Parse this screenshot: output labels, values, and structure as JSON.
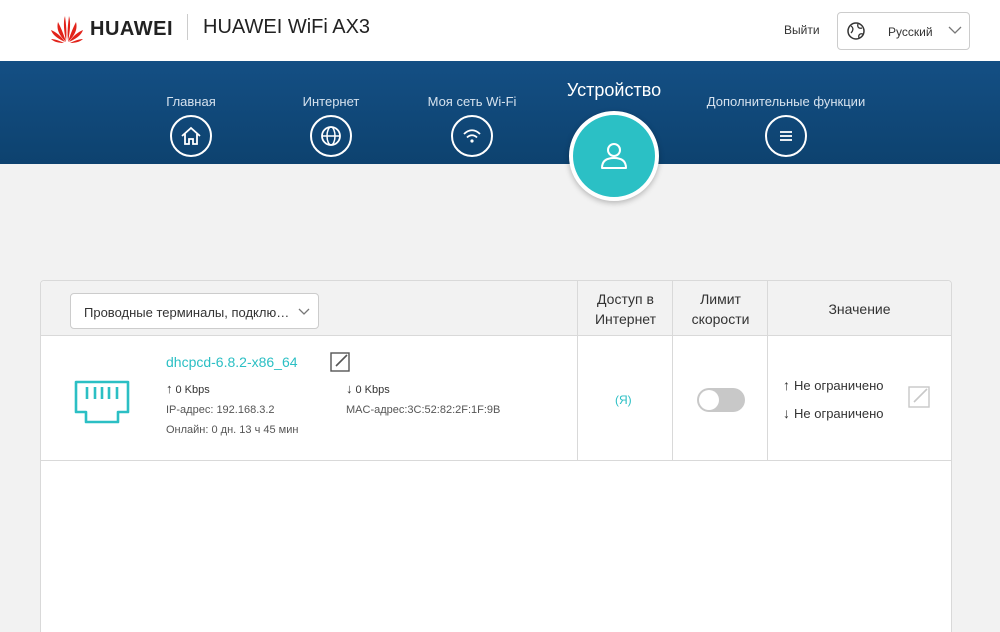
{
  "header": {
    "brand": "HUAWEI",
    "product": "HUAWEI WiFi AX3",
    "logout": "Выйти",
    "language": "Русский"
  },
  "nav": {
    "items": [
      {
        "label": "Главная",
        "icon": "home-icon"
      },
      {
        "label": "Интернет",
        "icon": "globe-icon"
      },
      {
        "label": "Моя сеть Wi-Fi",
        "icon": "wifi-icon"
      },
      {
        "label": "Устройство",
        "icon": "user-icon",
        "active": true
      },
      {
        "label": "Дополнительные функции",
        "icon": "menu-icon"
      }
    ]
  },
  "table": {
    "filter": "Проводные терминалы, подклю…",
    "headers": {
      "access_line1": "Доступ в",
      "access_line2": "Интернет",
      "limit_line1": "Лимит",
      "limit_line2": "скорости",
      "value": "Значение"
    },
    "rows": [
      {
        "name": "dhcpcd-6.8.2-x86_64",
        "up": "0 Kbps",
        "down": "0 Kbps",
        "ip": "IP-адрес: 192.168.3.2",
        "mac": "MAC-адрес:3C:52:82:2F:1F:9B",
        "online": "Онлайн: 0 дн. 13 ч 45 мин",
        "access": "(Я)",
        "speed_limit_on": false,
        "up_limit": "Не ограничено",
        "down_limit": "Не ограничено"
      }
    ]
  },
  "colors": {
    "accent": "#2bbfc4",
    "nav_bg": "#144f84",
    "logo_red": "#e2231a"
  }
}
